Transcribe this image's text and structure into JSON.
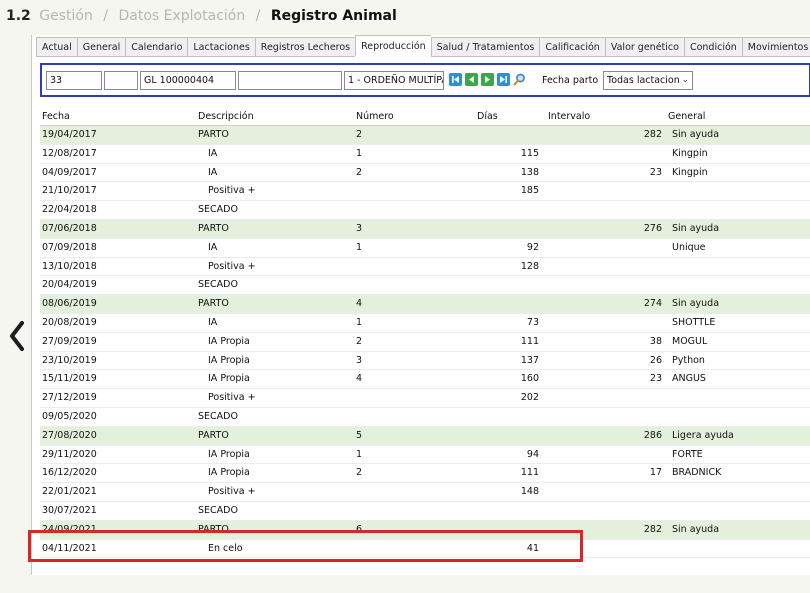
{
  "breadcrumb": {
    "number": "1.2",
    "items": [
      "Gestión",
      "Datos Explotación"
    ],
    "separator": "/",
    "current": "Registro Animal"
  },
  "tabs": [
    {
      "label": "Actual",
      "active": false
    },
    {
      "label": "General",
      "active": false
    },
    {
      "label": "Calendario",
      "active": false
    },
    {
      "label": "Lactaciones",
      "active": false
    },
    {
      "label": "Registros Lecheros",
      "active": false
    },
    {
      "label": "Reproducción",
      "active": true
    },
    {
      "label": "Salud / Tratamientos",
      "active": false
    },
    {
      "label": "Calificación",
      "active": false
    },
    {
      "label": "Valor genético",
      "active": false
    },
    {
      "label": "Condición",
      "active": false
    },
    {
      "label": "Movimientos",
      "active": false
    }
  ],
  "toolbar": {
    "field1": "33",
    "field2": "",
    "field3": "GL 100000404",
    "field4": "",
    "field5": "1 - ORDEÑO MULTÍPA",
    "fecha_parto_label": "Fecha parto",
    "lactation_select": "Todas lactacion"
  },
  "columns": {
    "fecha": "Fecha",
    "descripcion": "Descripción",
    "numero": "Número",
    "dias": "Días",
    "intervalo": "Intervalo",
    "general": "General"
  },
  "rows": [
    {
      "fecha": "19/04/2017",
      "desc": "PARTO",
      "num": "2",
      "dias": "",
      "int": "282",
      "gen": "Sin ayuda",
      "type": "parto"
    },
    {
      "fecha": "12/08/2017",
      "desc": "IA",
      "num": "1",
      "dias": "115",
      "int": "",
      "gen": "Kingpin",
      "type": "sub"
    },
    {
      "fecha": "04/09/2017",
      "desc": "IA",
      "num": "2",
      "dias": "138",
      "int": "23",
      "gen": "Kingpin",
      "type": "sub"
    },
    {
      "fecha": "21/10/2017",
      "desc": "Positiva +",
      "num": "",
      "dias": "185",
      "int": "",
      "gen": "",
      "type": "sub"
    },
    {
      "fecha": "22/04/2018",
      "desc": "SECADO",
      "num": "",
      "dias": "",
      "int": "",
      "gen": "",
      "type": "plain"
    },
    {
      "fecha": "07/06/2018",
      "desc": "PARTO",
      "num": "3",
      "dias": "",
      "int": "276",
      "gen": "Sin ayuda",
      "type": "parto"
    },
    {
      "fecha": "07/09/2018",
      "desc": "IA",
      "num": "1",
      "dias": "92",
      "int": "",
      "gen": "Unique",
      "type": "sub"
    },
    {
      "fecha": "13/10/2018",
      "desc": "Positiva +",
      "num": "",
      "dias": "128",
      "int": "",
      "gen": "",
      "type": "sub"
    },
    {
      "fecha": "20/04/2019",
      "desc": "SECADO",
      "num": "",
      "dias": "",
      "int": "",
      "gen": "",
      "type": "plain"
    },
    {
      "fecha": "08/06/2019",
      "desc": "PARTO",
      "num": "4",
      "dias": "",
      "int": "274",
      "gen": "Sin ayuda",
      "type": "parto"
    },
    {
      "fecha": "20/08/2019",
      "desc": "IA",
      "num": "1",
      "dias": "73",
      "int": "",
      "gen": "SHOTTLE",
      "type": "sub"
    },
    {
      "fecha": "27/09/2019",
      "desc": "IA Propia",
      "num": "2",
      "dias": "111",
      "int": "38",
      "gen": "MOGUL",
      "type": "sub"
    },
    {
      "fecha": "23/10/2019",
      "desc": "IA Propia",
      "num": "3",
      "dias": "137",
      "int": "26",
      "gen": "Python",
      "type": "sub"
    },
    {
      "fecha": "15/11/2019",
      "desc": "IA Propia",
      "num": "4",
      "dias": "160",
      "int": "23",
      "gen": "ANGUS",
      "type": "sub"
    },
    {
      "fecha": "27/12/2019",
      "desc": "Positiva +",
      "num": "",
      "dias": "202",
      "int": "",
      "gen": "",
      "type": "sub"
    },
    {
      "fecha": "09/05/2020",
      "desc": "SECADO",
      "num": "",
      "dias": "",
      "int": "",
      "gen": "",
      "type": "plain"
    },
    {
      "fecha": "27/08/2020",
      "desc": "PARTO",
      "num": "5",
      "dias": "",
      "int": "286",
      "gen": "Ligera ayuda",
      "type": "parto"
    },
    {
      "fecha": "29/11/2020",
      "desc": "IA Propia",
      "num": "1",
      "dias": "94",
      "int": "",
      "gen": "FORTE",
      "type": "sub"
    },
    {
      "fecha": "16/12/2020",
      "desc": "IA Propia",
      "num": "2",
      "dias": "111",
      "int": "17",
      "gen": "BRADNICK",
      "type": "sub"
    },
    {
      "fecha": "22/01/2021",
      "desc": "Positiva +",
      "num": "",
      "dias": "148",
      "int": "",
      "gen": "",
      "type": "sub"
    },
    {
      "fecha": "30/07/2021",
      "desc": "SECADO",
      "num": "",
      "dias": "",
      "int": "",
      "gen": "",
      "type": "plain"
    },
    {
      "fecha": "24/09/2021",
      "desc": "PARTO",
      "num": "6",
      "dias": "",
      "int": "282",
      "gen": "Sin ayuda",
      "type": "parto"
    },
    {
      "fecha": "04/11/2021",
      "desc": "En celo",
      "num": "",
      "dias": "41",
      "int": "",
      "gen": "",
      "type": "sub"
    }
  ],
  "colors": {
    "toolbar_border": "#2f3fb3",
    "parto_row_bg": "#e3f0dc",
    "highlight_border": "#d9262a",
    "nav_button": "#2f8fd6"
  }
}
